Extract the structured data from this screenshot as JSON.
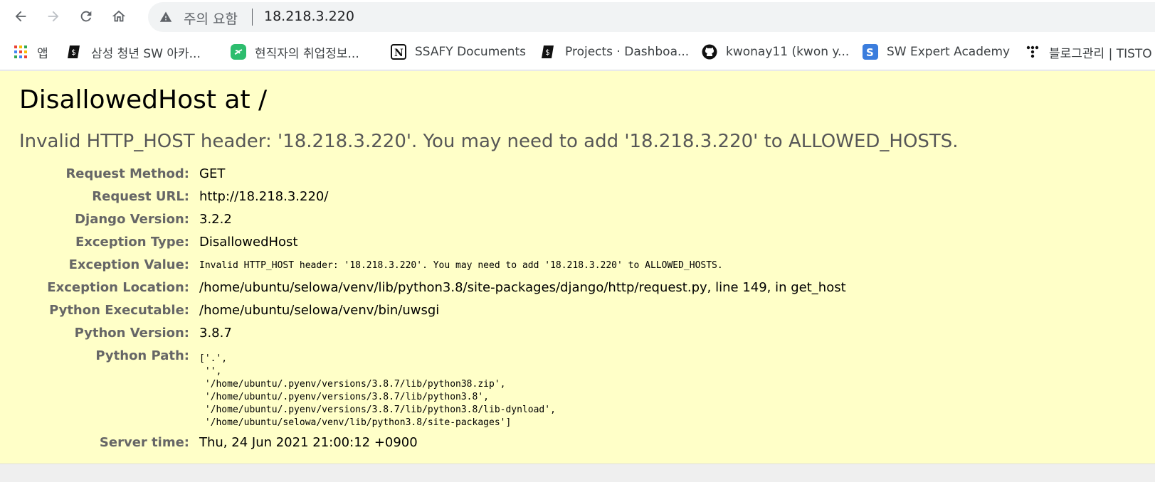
{
  "browser": {
    "security_label": "주의 요함",
    "url": "18.218.3.220"
  },
  "bookmarks": [
    {
      "label": "앱",
      "icon": "apps-grid-icon"
    },
    {
      "label": "삼성 청년 SW 아카...",
      "icon": "dollar-terminal-icon"
    },
    {
      "label": "현직자의 취업정보...",
      "icon": "green-link-icon"
    },
    {
      "label": "SSAFY Documents",
      "icon": "notion-icon"
    },
    {
      "label": "Projects · Dashboa...",
      "icon": "dollar-terminal-icon"
    },
    {
      "label": "kwonay11 (kwon y...",
      "icon": "github-icon"
    },
    {
      "label": "SW Expert Academy",
      "icon": "swea-icon"
    },
    {
      "label": "블로그관리 | TISTO",
      "icon": "tistory-icon"
    }
  ],
  "error": {
    "title": "DisallowedHost at /",
    "message": "Invalid HTTP_HOST header: '18.218.3.220'. You may need to add '18.218.3.220' to ALLOWED_HOSTS.",
    "rows": [
      {
        "label": "Request Method:",
        "value": "GET"
      },
      {
        "label": "Request URL:",
        "value": "http://18.218.3.220/"
      },
      {
        "label": "Django Version:",
        "value": "3.2.2"
      },
      {
        "label": "Exception Type:",
        "value": "DisallowedHost"
      },
      {
        "label": "Exception Value:",
        "value": "Invalid HTTP_HOST header: '18.218.3.220'. You may need to add '18.218.3.220' to ALLOWED_HOSTS."
      },
      {
        "label": "Exception Location:",
        "value": "/home/ubuntu/selowa/venv/lib/python3.8/site-packages/django/http/request.py, line 149, in get_host"
      },
      {
        "label": "Python Executable:",
        "value": "/home/ubuntu/selowa/venv/bin/uwsgi"
      },
      {
        "label": "Python Version:",
        "value": "3.8.7"
      },
      {
        "label": "Python Path:",
        "value": "['.',\n '',\n '/home/ubuntu/.pyenv/versions/3.8.7/lib/python38.zip',\n '/home/ubuntu/.pyenv/versions/3.8.7/lib/python3.8',\n '/home/ubuntu/.pyenv/versions/3.8.7/lib/python3.8/lib-dynload',\n '/home/ubuntu/selowa/venv/lib/python3.8/site-packages']"
      },
      {
        "label": "Server time:",
        "value": "Thu, 24 Jun 2021 21:00:12 +0900"
      }
    ]
  }
}
